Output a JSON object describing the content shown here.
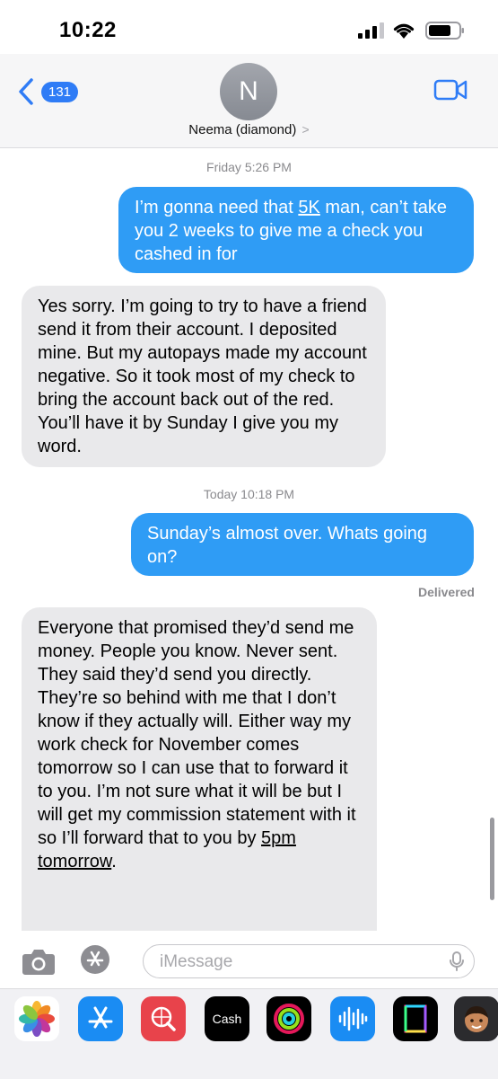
{
  "status_bar": {
    "time": "10:22"
  },
  "header": {
    "back_count": "131",
    "avatar_initial": "N",
    "contact_name": "Neema (diamond)",
    "contact_chevron": ">"
  },
  "thread": {
    "stamp_friday": "Friday 5:26 PM",
    "msg1_pre": "I’m gonna need that ",
    "msg1_link": "5K",
    "msg1_post": " man, can’t take you 2 weeks to give me a check you cashed in for",
    "msg2": "Yes sorry. I’m going to try to have a friend send it from their account. I deposited mine. But my autopays made my account negative. So it took most of my check to bring the account back out of the red. You’ll have it by Sunday I give you my word.",
    "stamp_today": "Today 10:18 PM",
    "msg3": "Sunday’s almost over. Whats going on?",
    "delivered": "Delivered",
    "msg4_pre": "Everyone that promised they’d send me money. People you know. Never sent. They said they’d send you directly. They’re so behind with me that I don’t know if they actually will. Either way my work check for November comes tomorrow so I can use that to forward it to you. I’m not sure what it will be but I will get my commission statement with it so I’ll forward that to you by ",
    "msg4_link": "5pm tomorrow",
    "msg4_post": "."
  },
  "composer": {
    "placeholder": "iMessage"
  },
  "tray": {
    "apps": [
      {
        "icon": "photos-icon"
      },
      {
        "icon": "app-store-icon"
      },
      {
        "icon": "web-search-icon"
      },
      {
        "icon": "apple-cash-icon",
        "label": "Cash"
      },
      {
        "icon": "fitness-icon"
      },
      {
        "icon": "audio-message-icon"
      },
      {
        "icon": "gif-icon"
      },
      {
        "icon": "memoji-icon"
      }
    ]
  },
  "colors": {
    "accent": "#2f7cf6",
    "outgoing_bubble": "#2f9cf5",
    "incoming_bubble": "#e9e9eb",
    "meta_text": "#8a8a8e"
  }
}
